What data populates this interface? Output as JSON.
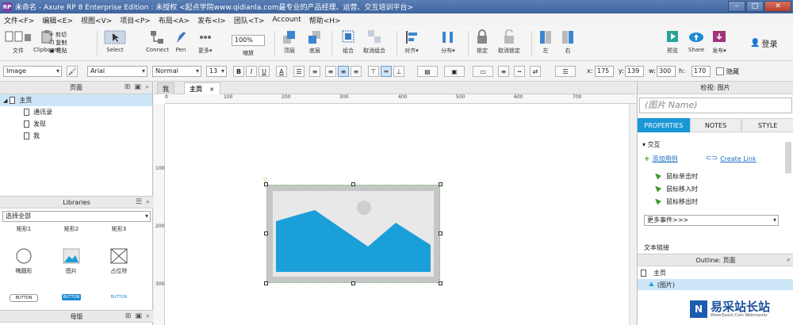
{
  "window": {
    "app_logo": "RP",
    "title": "未命名 - Axure RP 8 Enterprise Edition : 未授权      <起点学院www.qidianla.com最专业的产品经理、运营、交互培训平台>",
    "minimize": "–",
    "maximize": "□",
    "close": "✕"
  },
  "menubar": [
    "文件<F>",
    "编辑<E>",
    "视图<V>",
    "项目<P>",
    "布局<A>",
    "发布<I>",
    "团队<T>",
    "Account",
    "帮助<H>"
  ],
  "toolbar": {
    "file": "文件",
    "clipboard": "Clipboard",
    "cut": "剪切",
    "copy": "复制",
    "paste": "粘贴",
    "select": "Select",
    "connect": "Connect",
    "pen": "Pen",
    "more": "更多▾",
    "zoom_value": "100%",
    "zoom_label": "缩放",
    "top": "顶层",
    "bottom": "底层",
    "group": "组合",
    "ungroup": "取消组合",
    "align": "对齐▾",
    "distribute": "分布▾",
    "lock": "锁定",
    "unlock": "取消锁定",
    "left": "左",
    "right": "右",
    "preview": "预览",
    "share": "Share",
    "publish": "发布▾",
    "login": "登录"
  },
  "formatbar": {
    "widget_type": "Image",
    "font": "Arial",
    "style": "Normal",
    "size": "13",
    "bold": "B",
    "italic": "I",
    "underline": "U",
    "text_color": "A",
    "x_label": "x:",
    "x_value": "175",
    "y_label": "y:",
    "y_value": "139",
    "w_label": "w:",
    "w_value": "300",
    "h_label": "h:",
    "h_value": "170",
    "hide_label": "隐藏"
  },
  "pages_panel": {
    "title": "页面",
    "root": "主页",
    "children": [
      "通讯录",
      "发现",
      "我"
    ]
  },
  "libraries_panel": {
    "title": "Libraries",
    "filter": "选择全部",
    "row1": [
      "矩形1",
      "矩形2",
      "矩形3"
    ],
    "row2": [
      "椭圆形",
      "图片",
      "占位符"
    ],
    "row3": [
      "BUTTON",
      "BUTTON",
      "BUTTON"
    ]
  },
  "masters_panel": {
    "title": "母版"
  },
  "canvas": {
    "tabs": [
      "我",
      "主页"
    ],
    "ruler_h": [
      "0",
      "100",
      "200",
      "300",
      "400",
      "500",
      "600",
      "700"
    ],
    "ruler_v": [
      "100",
      "200",
      "300"
    ],
    "image_sky": "#e8e8e8",
    "image_mountain": "#1b9fd9",
    "image_sun": "#cfcfcf"
  },
  "inspector": {
    "title": "检视: 图片",
    "name_placeholder": "(图片 Name)",
    "tabs": [
      "PROPERTIES",
      "NOTES",
      "STYLE"
    ],
    "section": "交互",
    "add_case": "添加用例",
    "create_link": "Create Link",
    "events": [
      "鼠标单击时",
      "鼠标移入时",
      "鼠标移出时"
    ],
    "more_events": "更多事件>>>",
    "text_link": "文本链接"
  },
  "outline": {
    "title": "Outline: 页面",
    "root": "主页",
    "item": "(图片)"
  },
  "watermark": {
    "logo": "N",
    "title": "易采站长站",
    "subtitle": "Www.Easck.Com Webmaster"
  }
}
